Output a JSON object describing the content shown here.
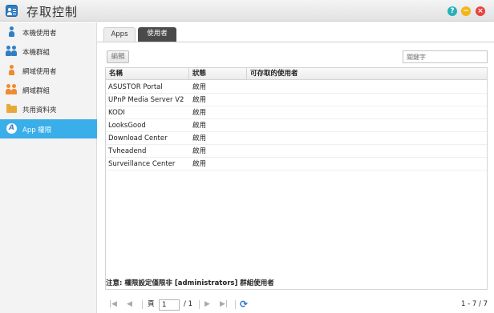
{
  "window": {
    "title": "存取控制"
  },
  "sidebar": {
    "items": [
      {
        "label": "本機使用者",
        "icon": "user-icon"
      },
      {
        "label": "本機群組",
        "icon": "group-icon"
      },
      {
        "label": "網域使用者",
        "icon": "domain-user-icon"
      },
      {
        "label": "網域群組",
        "icon": "domain-group-icon"
      },
      {
        "label": "共用資料夾",
        "icon": "folder-icon"
      },
      {
        "label": "App 權限",
        "icon": "app-icon",
        "active": true
      }
    ]
  },
  "tabs": [
    {
      "label": "Apps",
      "active": true
    },
    {
      "label": "使用者",
      "active": false
    }
  ],
  "toolbar": {
    "edit_label": "編輯",
    "search_placeholder": "關鍵字"
  },
  "table": {
    "columns": [
      "名稱",
      "狀態",
      "可存取的使用者"
    ],
    "rows": [
      {
        "name": "ASUSTOR Portal",
        "status": "啟用",
        "users": ""
      },
      {
        "name": "UPnP Media Server V2",
        "status": "啟用",
        "users": ""
      },
      {
        "name": "KODI",
        "status": "啟用",
        "users": ""
      },
      {
        "name": "LooksGood",
        "status": "啟用",
        "users": ""
      },
      {
        "name": "Download Center",
        "status": "啟用",
        "users": ""
      },
      {
        "name": "Tvheadend",
        "status": "啟用",
        "users": ""
      },
      {
        "name": "Surveillance Center",
        "status": "啟用",
        "users": ""
      }
    ]
  },
  "pager": {
    "page_label": "頁",
    "current_page": "1",
    "total_pages": "/ 1",
    "range": "1 - 7 / 7"
  },
  "note": "注意: 權限設定僅限非 [administrators] 群組使用者",
  "colors": {
    "accent": "#3aaee8",
    "active_tab": "#4a4a4a",
    "help": "#27b0b8",
    "minimize": "#f2b51c",
    "close": "#e8423f"
  }
}
